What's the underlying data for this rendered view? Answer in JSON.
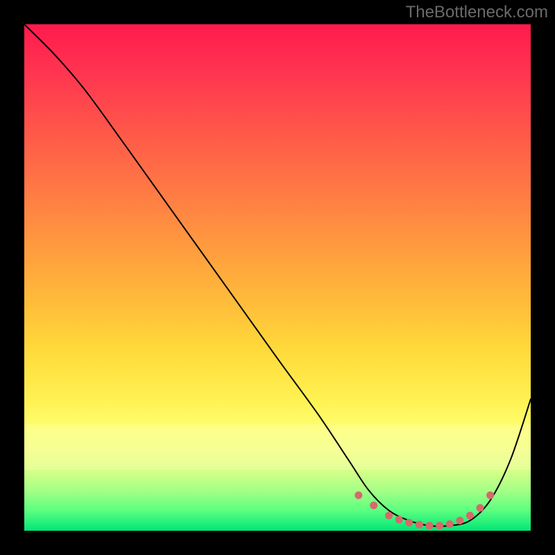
{
  "watermark": "TheBottleneck.com",
  "yellow_band": {
    "top_frac": 0.79,
    "height_frac": 0.09
  },
  "chart_data": {
    "type": "line",
    "title": "",
    "xlabel": "",
    "ylabel": "",
    "xlim": [
      0,
      100
    ],
    "ylim": [
      0,
      100
    ],
    "series": [
      {
        "name": "bottleneck-curve",
        "x": [
          0,
          6,
          12,
          20,
          30,
          40,
          50,
          58,
          64,
          68,
          72,
          76,
          80,
          84,
          88,
          92,
          96,
          100
        ],
        "y": [
          100,
          94,
          87,
          76,
          62,
          48,
          34,
          23,
          14,
          8,
          4,
          2,
          1,
          1,
          2,
          6,
          14,
          26
        ],
        "stroke": "#000000",
        "stroke_width": 2
      }
    ],
    "markers": {
      "name": "optimal-range-dots",
      "x": [
        66,
        69,
        72,
        74,
        76,
        78,
        80,
        82,
        84,
        86,
        88,
        90,
        92
      ],
      "y": [
        7,
        5,
        3,
        2.2,
        1.6,
        1.2,
        1,
        1,
        1.3,
        2,
        3,
        4.5,
        7
      ],
      "r": 5.5,
      "fill": "#d46a6a"
    }
  }
}
